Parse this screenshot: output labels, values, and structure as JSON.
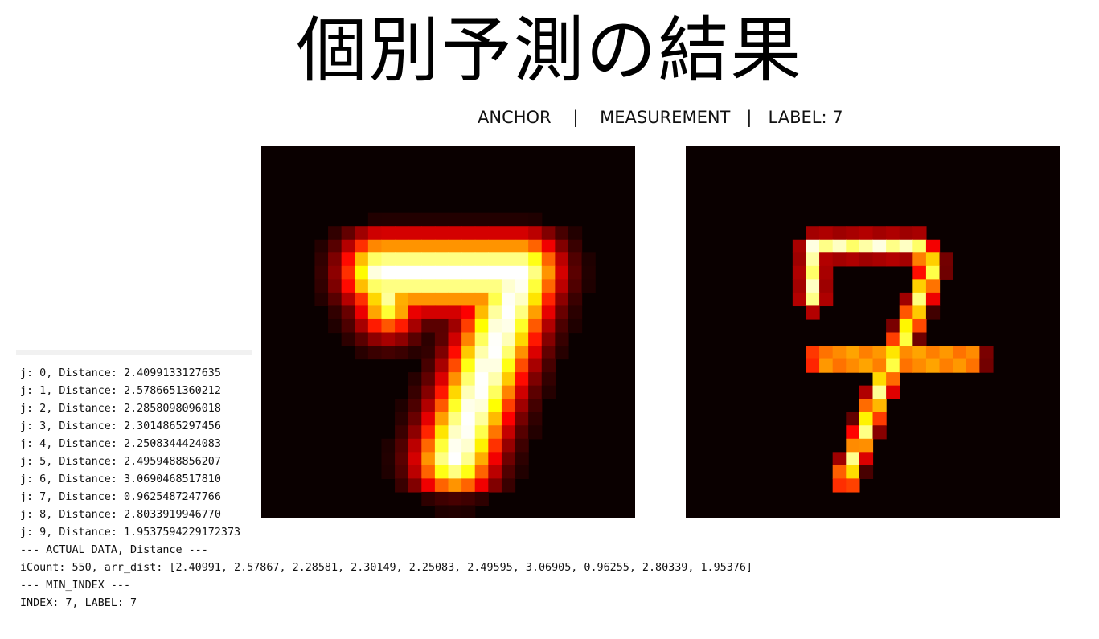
{
  "title": "個別予測の結果",
  "subtitle": {
    "left": "ANCHOR",
    "sep1": "|",
    "middle": "MEASUREMENT",
    "sep2": "|",
    "right": "LABEL: 7"
  },
  "console": {
    "lines": [
      "j: 0, Distance: 2.4099133127635",
      "j: 1, Distance: 2.5786651360212",
      "j: 2, Distance: 2.2858098096018",
      "j: 3, Distance: 2.3014865297456",
      "j: 4, Distance: 2.2508344424083",
      "j: 5, Distance: 2.4959488856207",
      "j: 6, Distance: 3.0690468517810",
      "j: 7, Distance: 0.9625487247766",
      "j: 8, Distance: 2.8033919946770",
      "j: 9, Distance: 1.9537594229172373",
      "--- ACTUAL DATA, Distance ---",
      "iCount: 550, arr_dist: [2.40991, 2.57867, 2.28581, 2.30149, 2.25083, 2.49595, 3.06905, 0.96255, 2.80339, 1.95376]",
      "--- MIN_INDEX ---",
      "INDEX: 7, LABEL: 7"
    ]
  },
  "images": {
    "colormap": "hot",
    "anchor": {
      "name": "anchor-heatmap",
      "grid": 28
    },
    "measurement": {
      "name": "measurement-heatmap",
      "grid": 28
    }
  }
}
